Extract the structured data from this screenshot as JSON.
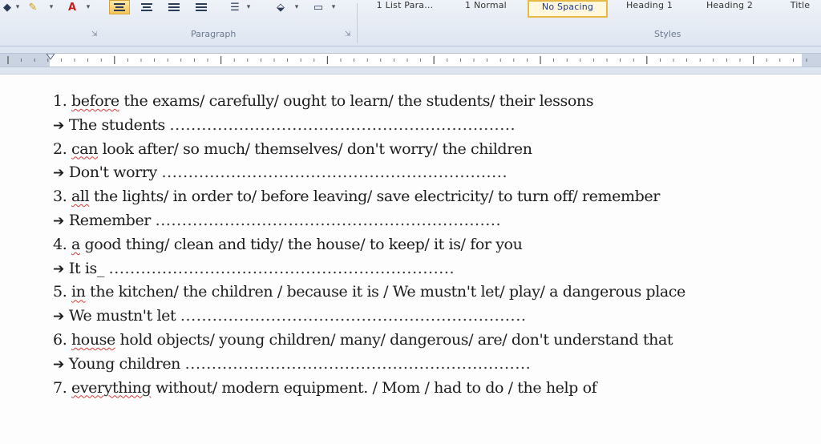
{
  "ribbon": {
    "paragraph_label": "Paragraph",
    "styles_label": "Styles",
    "styles": [
      "1 List Para...",
      "1 Normal",
      "No Spacing",
      "Heading 1",
      "Heading 2",
      "Title"
    ],
    "font_color_glyph": "A"
  },
  "document": {
    "lines": [
      {
        "kind": "question",
        "num": "1.",
        "pre": "",
        "err": "before",
        "rest": " the exams/ carefully/ ought to learn/ the students/ their lessons"
      },
      {
        "kind": "answer",
        "start": "The students",
        "dots": "................................................................."
      },
      {
        "kind": "question",
        "num": "2.",
        "pre": "",
        "err": "can",
        "rest": " look after/ so much/ themselves/ don't worry/ the children"
      },
      {
        "kind": "answer",
        "start": "Don't worry",
        "dots": "................................................................."
      },
      {
        "kind": "question",
        "num": "3.",
        "pre": "",
        "err": "all",
        "rest": " the lights/ in order to/ before leaving/ save electricity/ to turn off/ remember"
      },
      {
        "kind": "answer",
        "start": "Remember",
        "dots": "................................................................."
      },
      {
        "kind": "question",
        "num": "4.",
        "pre": "",
        "err": "a",
        "rest": " good thing/ clean and tidy/ the house/ to keep/ it is/ for you"
      },
      {
        "kind": "answer",
        "start": "It is_",
        "dots": "................................................................."
      },
      {
        "kind": "question",
        "num": "5.",
        "pre": "",
        "err": "in",
        "rest": " the kitchen/ the children / because it is / We mustn't let/ play/ a dangerous place"
      },
      {
        "kind": "answer",
        "start": "We mustn't let",
        "dots": "................................................................."
      },
      {
        "kind": "question",
        "num": "6.",
        "pre": "",
        "err": "house",
        "rest": " hold objects/ young children/ many/ dangerous/ are/ don't understand that"
      },
      {
        "kind": "answer",
        "start": "Young children",
        "dots": "................................................................."
      },
      {
        "kind": "question",
        "num": "7.",
        "pre": "",
        "err": "everything",
        "rest": " without/ modern equipment. / Mom / had to do / the help of"
      }
    ]
  }
}
